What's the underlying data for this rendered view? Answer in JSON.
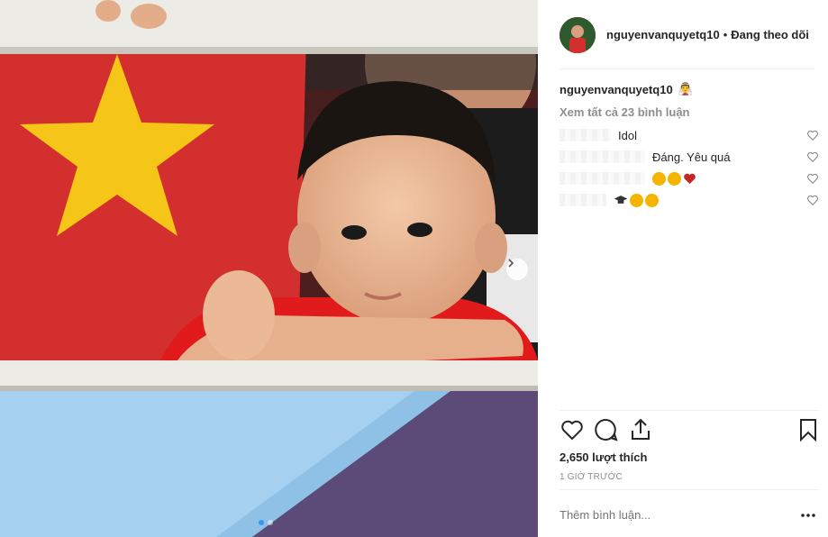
{
  "post": {
    "username": "nguyenvanquyetq10",
    "separator": "•",
    "follow_label": "Đang theo dõi",
    "caption_emoji": "👰‍♂",
    "view_all_label": "Xem tất cả 23 bình luận",
    "comments": [
      {
        "text": "Idol"
      },
      {
        "text": "Đáng. Yêu quá"
      },
      {
        "text": "",
        "emojis": [
          "heart-eyes",
          "heart-eyes",
          "red-heart"
        ]
      },
      {
        "text": "",
        "emojis": [
          "graduation-cap",
          "smiling-face",
          "grinning-face"
        ]
      }
    ],
    "likes": "2,650 lượt thích",
    "time": "1 GIỜ TRƯỚC",
    "add_comment_placeholder": "Thêm bình luận...",
    "carousel": {
      "total": 2,
      "current": 1
    }
  },
  "colors": {
    "accent": "#3897f0",
    "text": "#262626",
    "muted": "#8e8e8e",
    "divider": "#efefef",
    "flag_red": "#d32f2f",
    "flag_star": "#f5c518"
  }
}
